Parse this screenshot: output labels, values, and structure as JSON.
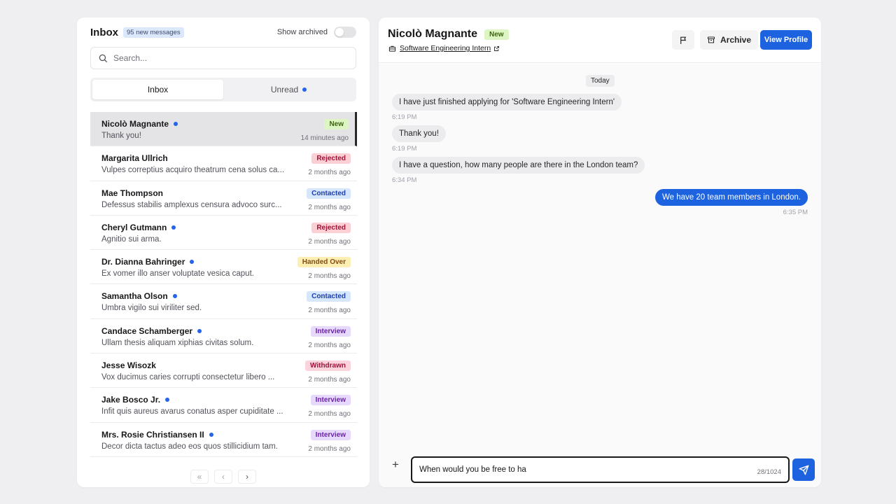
{
  "inbox": {
    "title": "Inbox",
    "new_count": "95 new messages",
    "show_archived_label": "Show archived",
    "show_archived": false,
    "search_placeholder": "Search...",
    "tabs": [
      {
        "label": "Inbox",
        "active": true
      },
      {
        "label": "Unread",
        "active": false
      }
    ]
  },
  "conversations": [
    {
      "name": "Nicolò Magnante",
      "unread": true,
      "preview": "Thank you!",
      "status": "New",
      "time": "14 minutes ago",
      "selected": true
    },
    {
      "name": "Margarita Ullrich",
      "unread": false,
      "preview": "Vulpes correptius acquiro theatrum cena solus ca...",
      "status": "Rejected",
      "time": "2 months ago"
    },
    {
      "name": "Mae Thompson",
      "unread": false,
      "preview": "Defessus stabilis amplexus censura advoco surc...",
      "status": "Contacted",
      "time": "2 months ago"
    },
    {
      "name": "Cheryl Gutmann",
      "unread": true,
      "preview": "Agnitio sui arma.",
      "status": "Rejected",
      "time": "2 months ago"
    },
    {
      "name": "Dr. Dianna Bahringer",
      "unread": true,
      "preview": "Ex vomer illo anser voluptate vesica caput.",
      "status": "Handed Over",
      "time": "2 months ago"
    },
    {
      "name": "Samantha Olson",
      "unread": true,
      "preview": "Umbra vigilo sui viriliter sed.",
      "status": "Contacted",
      "time": "2 months ago"
    },
    {
      "name": "Candace Schamberger",
      "unread": true,
      "preview": "Ullam thesis aliquam xiphias civitas solum.",
      "status": "Interview",
      "time": "2 months ago"
    },
    {
      "name": "Jesse Wisozk",
      "unread": false,
      "preview": "Vox ducimus caries corrupti consectetur libero ...",
      "status": "Withdrawn",
      "time": "2 months ago"
    },
    {
      "name": "Jake Bosco Jr.",
      "unread": true,
      "preview": "Infit quis aureus avarus conatus asper cupiditate ...",
      "status": "Interview",
      "time": "2 months ago"
    },
    {
      "name": "Mrs. Rosie Christiansen II",
      "unread": true,
      "preview": "Decor dicta tactus adeo eos quos stillicidium tam.",
      "status": "Interview",
      "time": "2 months ago"
    }
  ],
  "pagination": {
    "first": "«",
    "prev": "‹",
    "next": "›"
  },
  "chat": {
    "candidate_name": "Nicolò Magnante",
    "candidate_status": "New",
    "job_title": "Software Engineering Intern",
    "archive_label": "Archive",
    "view_profile_label": "View Profile",
    "day_label": "Today",
    "messages": [
      {
        "direction": "in",
        "text": "I have just finished applying for 'Software Engineering Intern'",
        "time": "6:19 PM"
      },
      {
        "direction": "in",
        "text": "Thank you!",
        "time": "6:19 PM"
      },
      {
        "direction": "in",
        "text": "I have a question, how many people are there in the London team?",
        "time": "6:34 PM"
      },
      {
        "direction": "out",
        "text": "We have 20 team members in London.",
        "time": "6:35 PM"
      }
    ],
    "composer_value": "When would you be free to ha",
    "char_count": "28/1024",
    "plus_label": "+"
  },
  "colors": {
    "accent": "#1d63e0",
    "unread_dot": "#2563eb"
  }
}
